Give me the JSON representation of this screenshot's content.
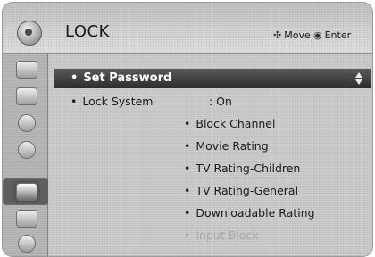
{
  "header": {
    "title": "LOCK",
    "hints": [
      {
        "icon": "dpad-arrows-icon",
        "label": "Move"
      },
      {
        "icon": "enter-dot-icon",
        "label": "Enter"
      }
    ]
  },
  "sidebar": {
    "items": [
      {
        "icon": "picture-icon"
      },
      {
        "icon": "screen-icon"
      },
      {
        "icon": "audio-icon"
      },
      {
        "icon": "time-icon"
      },
      {
        "icon": "lock-icon",
        "active": true
      },
      {
        "icon": "option-icon"
      },
      {
        "icon": "network-icon"
      }
    ]
  },
  "content": {
    "selected_row": "Set Password",
    "lock_system": {
      "label": "Lock System",
      "value": ": On"
    },
    "sub_items": [
      "Block Channel",
      "Movie Rating",
      "TV Rating-Children",
      "TV Rating-General",
      "Downloadable Rating",
      "Input Block"
    ]
  }
}
